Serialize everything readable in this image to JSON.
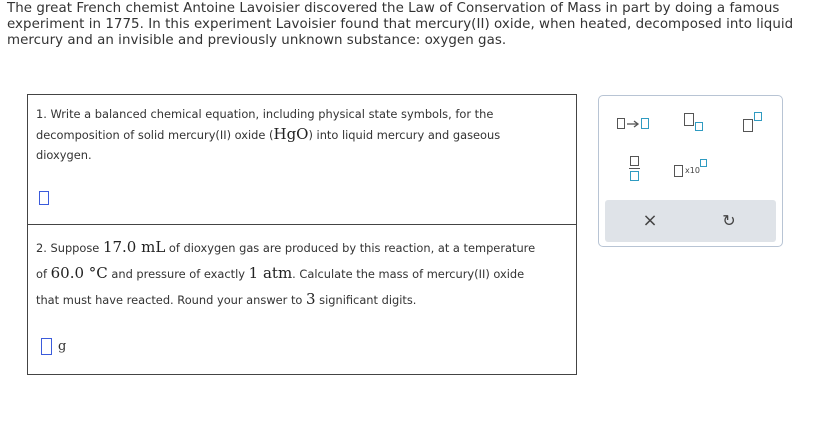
{
  "intro": {
    "line1": "The great French chemist Antoine Lavoisier discovered the Law of Conservation of Mass in part by doing a famous",
    "line2": "experiment in 1775. In this experiment Lavoisier found that mercury(II) oxide, when heated, decomposed into liquid",
    "line3": "mercury and an invisible and previously unknown substance: oxygen gas."
  },
  "question1": {
    "text_a": "1. Write a balanced chemical equation, including physical state symbols, for the",
    "text_b": "decomposition of solid mercury(II) oxide (",
    "formula": "HgO",
    "text_c": ") into liquid mercury and gaseous",
    "text_d": "dioxygen."
  },
  "question2": {
    "text_a": "2. Suppose ",
    "volume": "17.0 mL",
    "text_b": " of dioxygen gas are produced by this reaction, at a temperature",
    "text_c": "of ",
    "temperature": "60.0 °C",
    "text_d": " and pressure of exactly ",
    "pressure": "1 atm",
    "text_e": ". Calculate the mass of mercury(II) oxide",
    "text_f": "that must have reacted. Round your answer to ",
    "sigfigs": "3",
    "text_g": " significant digits.",
    "unit": "g"
  },
  "palette": {
    "x10_label": "x10",
    "clear_symbol": "×",
    "undo_symbol": "↻",
    "icons": [
      "reaction-arrow-icon",
      "subscript-icon",
      "superscript-icon",
      "fraction-icon",
      "scientific-notation-icon",
      "clear-icon",
      "undo-icon"
    ]
  }
}
